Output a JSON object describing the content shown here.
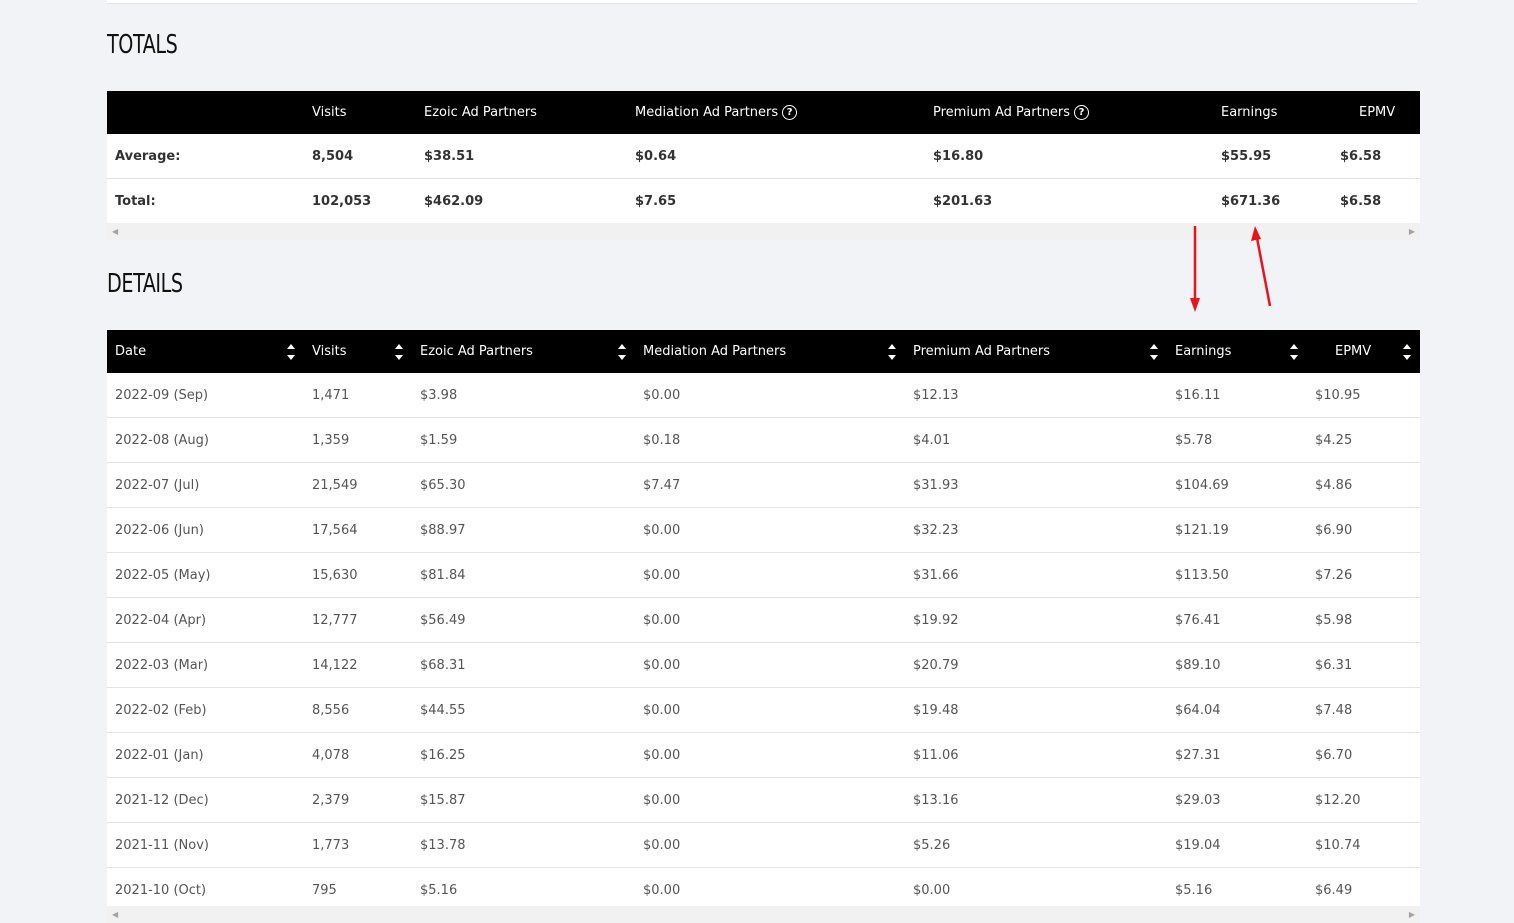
{
  "totals": {
    "title": "TOTALS",
    "headers": {
      "visits": "Visits",
      "ezoic": "Ezoic Ad Partners",
      "mediation": "Mediation Ad Partners",
      "premium": "Premium Ad Partners",
      "earnings": "Earnings",
      "epmv": "EPMV",
      "help_glyph": "?"
    },
    "average": {
      "label": "Average:",
      "visits": "8,504",
      "ezoic": "$38.51",
      "mediation": "$0.64",
      "premium": "$16.80",
      "earnings": "$55.95",
      "epmv": "$6.58"
    },
    "total": {
      "label": "Total:",
      "visits": "102,053",
      "ezoic": "$462.09",
      "mediation": "$7.65",
      "premium": "$201.63",
      "earnings": "$671.36",
      "epmv": "$6.58"
    }
  },
  "details": {
    "title": "DETAILS",
    "headers": {
      "date": "Date",
      "visits": "Visits",
      "ezoic": "Ezoic Ad Partners",
      "mediation": "Mediation Ad Partners",
      "premium": "Premium Ad Partners",
      "earnings": "Earnings",
      "epmv": "EPMV"
    },
    "rows": [
      {
        "date": "2022-09 (Sep)",
        "visits": "1,471",
        "ezoic": "$3.98",
        "mediation": "$0.00",
        "premium": "$12.13",
        "earnings": "$16.11",
        "epmv": "$10.95"
      },
      {
        "date": "2022-08 (Aug)",
        "visits": "1,359",
        "ezoic": "$1.59",
        "mediation": "$0.18",
        "premium": "$4.01",
        "earnings": "$5.78",
        "epmv": "$4.25"
      },
      {
        "date": "2022-07 (Jul)",
        "visits": "21,549",
        "ezoic": "$65.30",
        "mediation": "$7.47",
        "premium": "$31.93",
        "earnings": "$104.69",
        "epmv": "$4.86"
      },
      {
        "date": "2022-06 (Jun)",
        "visits": "17,564",
        "ezoic": "$88.97",
        "mediation": "$0.00",
        "premium": "$32.23",
        "earnings": "$121.19",
        "epmv": "$6.90"
      },
      {
        "date": "2022-05 (May)",
        "visits": "15,630",
        "ezoic": "$81.84",
        "mediation": "$0.00",
        "premium": "$31.66",
        "earnings": "$113.50",
        "epmv": "$7.26"
      },
      {
        "date": "2022-04 (Apr)",
        "visits": "12,777",
        "ezoic": "$56.49",
        "mediation": "$0.00",
        "premium": "$19.92",
        "earnings": "$76.41",
        "epmv": "$5.98"
      },
      {
        "date": "2022-03 (Mar)",
        "visits": "14,122",
        "ezoic": "$68.31",
        "mediation": "$0.00",
        "premium": "$20.79",
        "earnings": "$89.10",
        "epmv": "$6.31"
      },
      {
        "date": "2022-02 (Feb)",
        "visits": "8,556",
        "ezoic": "$44.55",
        "mediation": "$0.00",
        "premium": "$19.48",
        "earnings": "$64.04",
        "epmv": "$7.48"
      },
      {
        "date": "2022-01 (Jan)",
        "visits": "4,078",
        "ezoic": "$16.25",
        "mediation": "$0.00",
        "premium": "$11.06",
        "earnings": "$27.31",
        "epmv": "$6.70"
      },
      {
        "date": "2021-12 (Dec)",
        "visits": "2,379",
        "ezoic": "$15.87",
        "mediation": "$0.00",
        "premium": "$13.16",
        "earnings": "$29.03",
        "epmv": "$12.20"
      },
      {
        "date": "2021-11 (Nov)",
        "visits": "1,773",
        "ezoic": "$13.78",
        "mediation": "$0.00",
        "premium": "$5.26",
        "earnings": "$19.04",
        "epmv": "$10.74"
      },
      {
        "date": "2021-10 (Oct)",
        "visits": "795",
        "ezoic": "$5.16",
        "mediation": "$0.00",
        "premium": "$0.00",
        "earnings": "$5.16",
        "epmv": "$6.49"
      }
    ]
  },
  "icons": {
    "help": "help-circle-icon",
    "sort": "sort-updown-icon",
    "scroll_left": "scroll-left-arrow-icon",
    "scroll_right": "scroll-right-arrow-icon"
  },
  "colors": {
    "header_bg": "#000000",
    "annotation_arrow": "#e8141b"
  }
}
